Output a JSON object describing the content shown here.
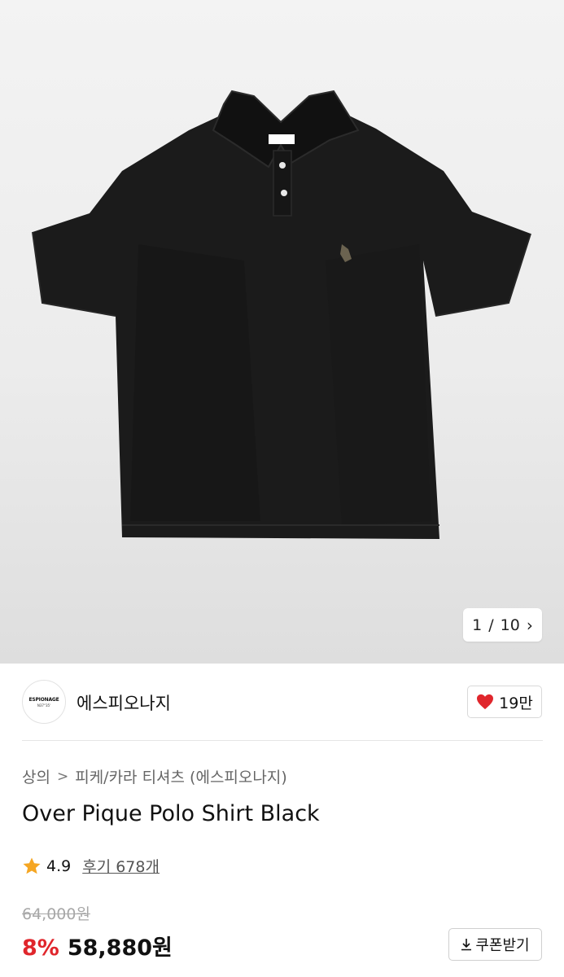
{
  "gallery": {
    "current": "1",
    "separator": "/",
    "total": "10",
    "next_icon": "chevron-right-icon"
  },
  "brand": {
    "logo_line1": "ESPIONAGE",
    "logo_line2": "N37°35'",
    "name": "에스피오나지"
  },
  "like": {
    "icon": "heart-icon",
    "icon_color": "#e0262c",
    "count": "19만"
  },
  "breadcrumb": {
    "category": "상의",
    "separator": ">",
    "subcategory": "피케/카라 티셔츠 (에스피오나지)"
  },
  "product": {
    "title": "Over Pique Polo Shirt Black"
  },
  "rating": {
    "icon": "star-icon",
    "icon_color": "#f5a623",
    "score": "4.9",
    "reviews": "후기 678개"
  },
  "price": {
    "original": "64,000원",
    "discount": "8%",
    "discount_color": "#e0262c",
    "sale": "58,880원"
  },
  "coupon": {
    "icon": "download-icon",
    "label": "쿠폰받기"
  }
}
